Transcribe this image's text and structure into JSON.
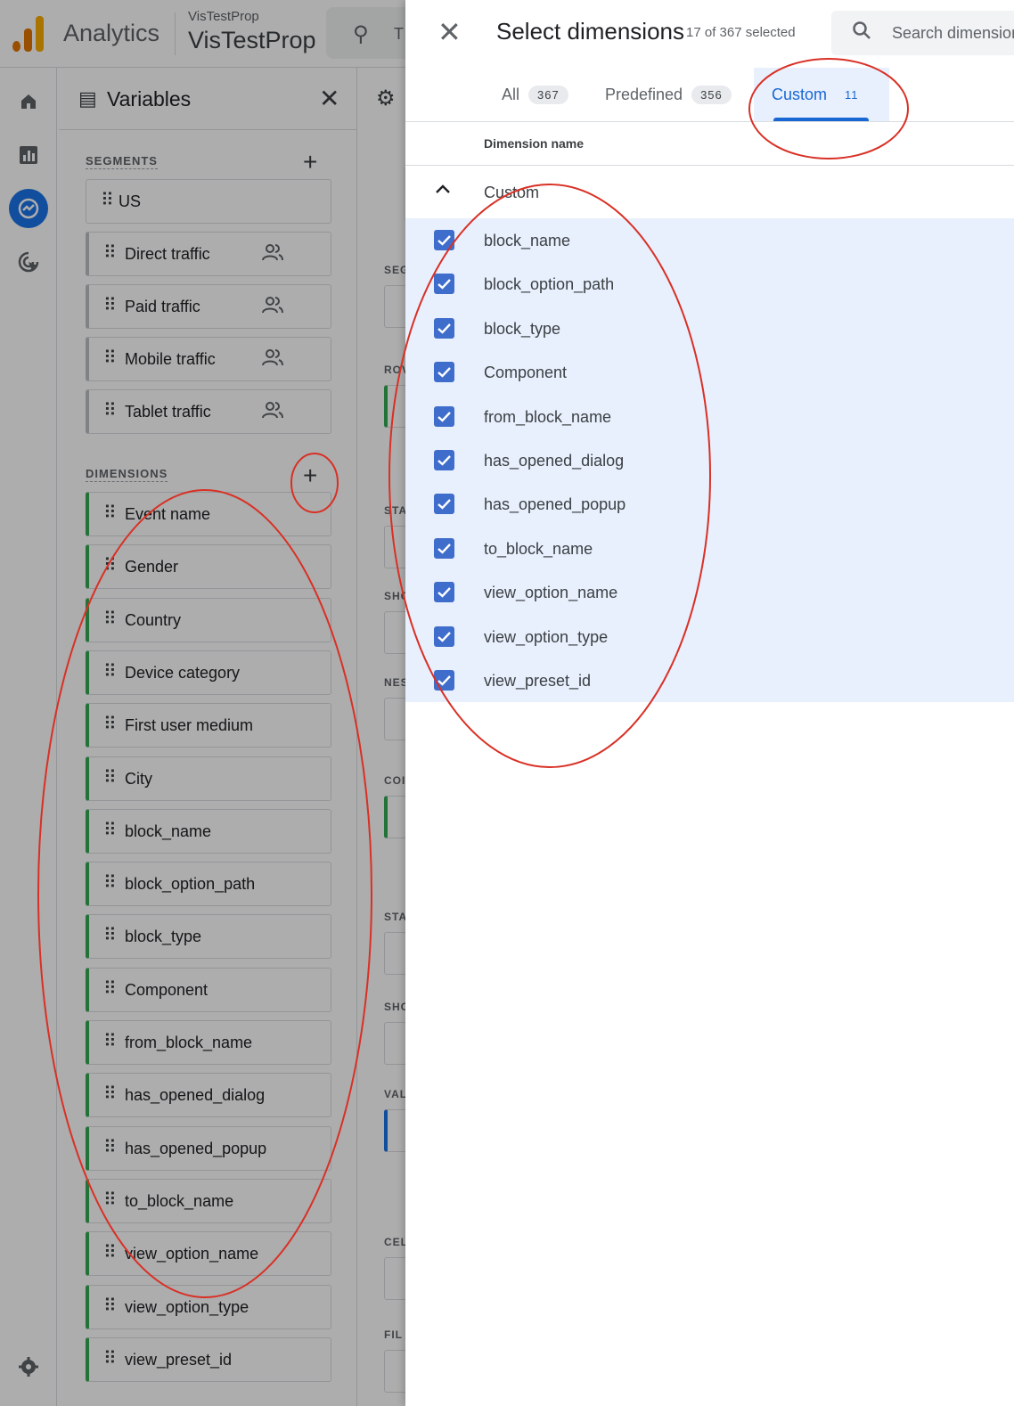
{
  "topbar": {
    "app_name": "Analytics",
    "account_small": "VisTestProp",
    "account_big": "VisTestProp",
    "search_partial": "T"
  },
  "left_nav": {
    "items": [
      "home-icon",
      "reports-icon",
      "explore-icon",
      "advertising-icon",
      "settings-icon"
    ]
  },
  "variables": {
    "title": "Variables",
    "segments_label": "SEGMENTS",
    "segments": [
      {
        "label": "US",
        "type": "plain"
      },
      {
        "label": "Direct traffic",
        "type": "audience"
      },
      {
        "label": "Paid traffic",
        "type": "audience"
      },
      {
        "label": "Mobile traffic",
        "type": "audience"
      },
      {
        "label": "Tablet traffic",
        "type": "audience"
      }
    ],
    "dimensions_label": "DIMENSIONS",
    "dimensions": [
      "Event name",
      "Gender",
      "Country",
      "Device category",
      "First user medium",
      "City",
      "block_name",
      "block_option_path",
      "block_type",
      "Component",
      "from_block_name",
      "has_opened_dialog",
      "has_opened_popup",
      "to_block_name",
      "view_option_name",
      "view_option_type",
      "view_preset_id"
    ]
  },
  "tab_settings": {
    "labels": [
      "SEG",
      "ROV",
      "STA",
      "SHO",
      "NES",
      "COI",
      "STA",
      "SHO",
      "VAL",
      "CEL",
      "FIL"
    ]
  },
  "dialog": {
    "title": "Select dimensions",
    "count": "17 of 367 selected",
    "search_placeholder": "Search dimensions",
    "tabs": [
      {
        "label": "All",
        "count": "367"
      },
      {
        "label": "Predefined",
        "count": "356"
      },
      {
        "label": "Custom",
        "count": "11"
      }
    ],
    "active_tab": "Custom",
    "column_header": "Dimension name",
    "group_label": "Custom",
    "rows": [
      {
        "label": "block_name",
        "checked": true
      },
      {
        "label": "block_option_path",
        "checked": true
      },
      {
        "label": "block_type",
        "checked": true
      },
      {
        "label": "Component",
        "checked": true
      },
      {
        "label": "from_block_name",
        "checked": true
      },
      {
        "label": "has_opened_dialog",
        "checked": true
      },
      {
        "label": "has_opened_popup",
        "checked": true
      },
      {
        "label": "to_block_name",
        "checked": true
      },
      {
        "label": "view_option_name",
        "checked": true
      },
      {
        "label": "view_option_type",
        "checked": true
      },
      {
        "label": "view_preset_id",
        "checked": true
      }
    ]
  },
  "colors": {
    "accent": "#1967d2",
    "checkbox": "#3f6dcc",
    "selected_bg": "#e8f0fe",
    "dimension_green": "#34a853",
    "annotation_red": "#d93025"
  }
}
